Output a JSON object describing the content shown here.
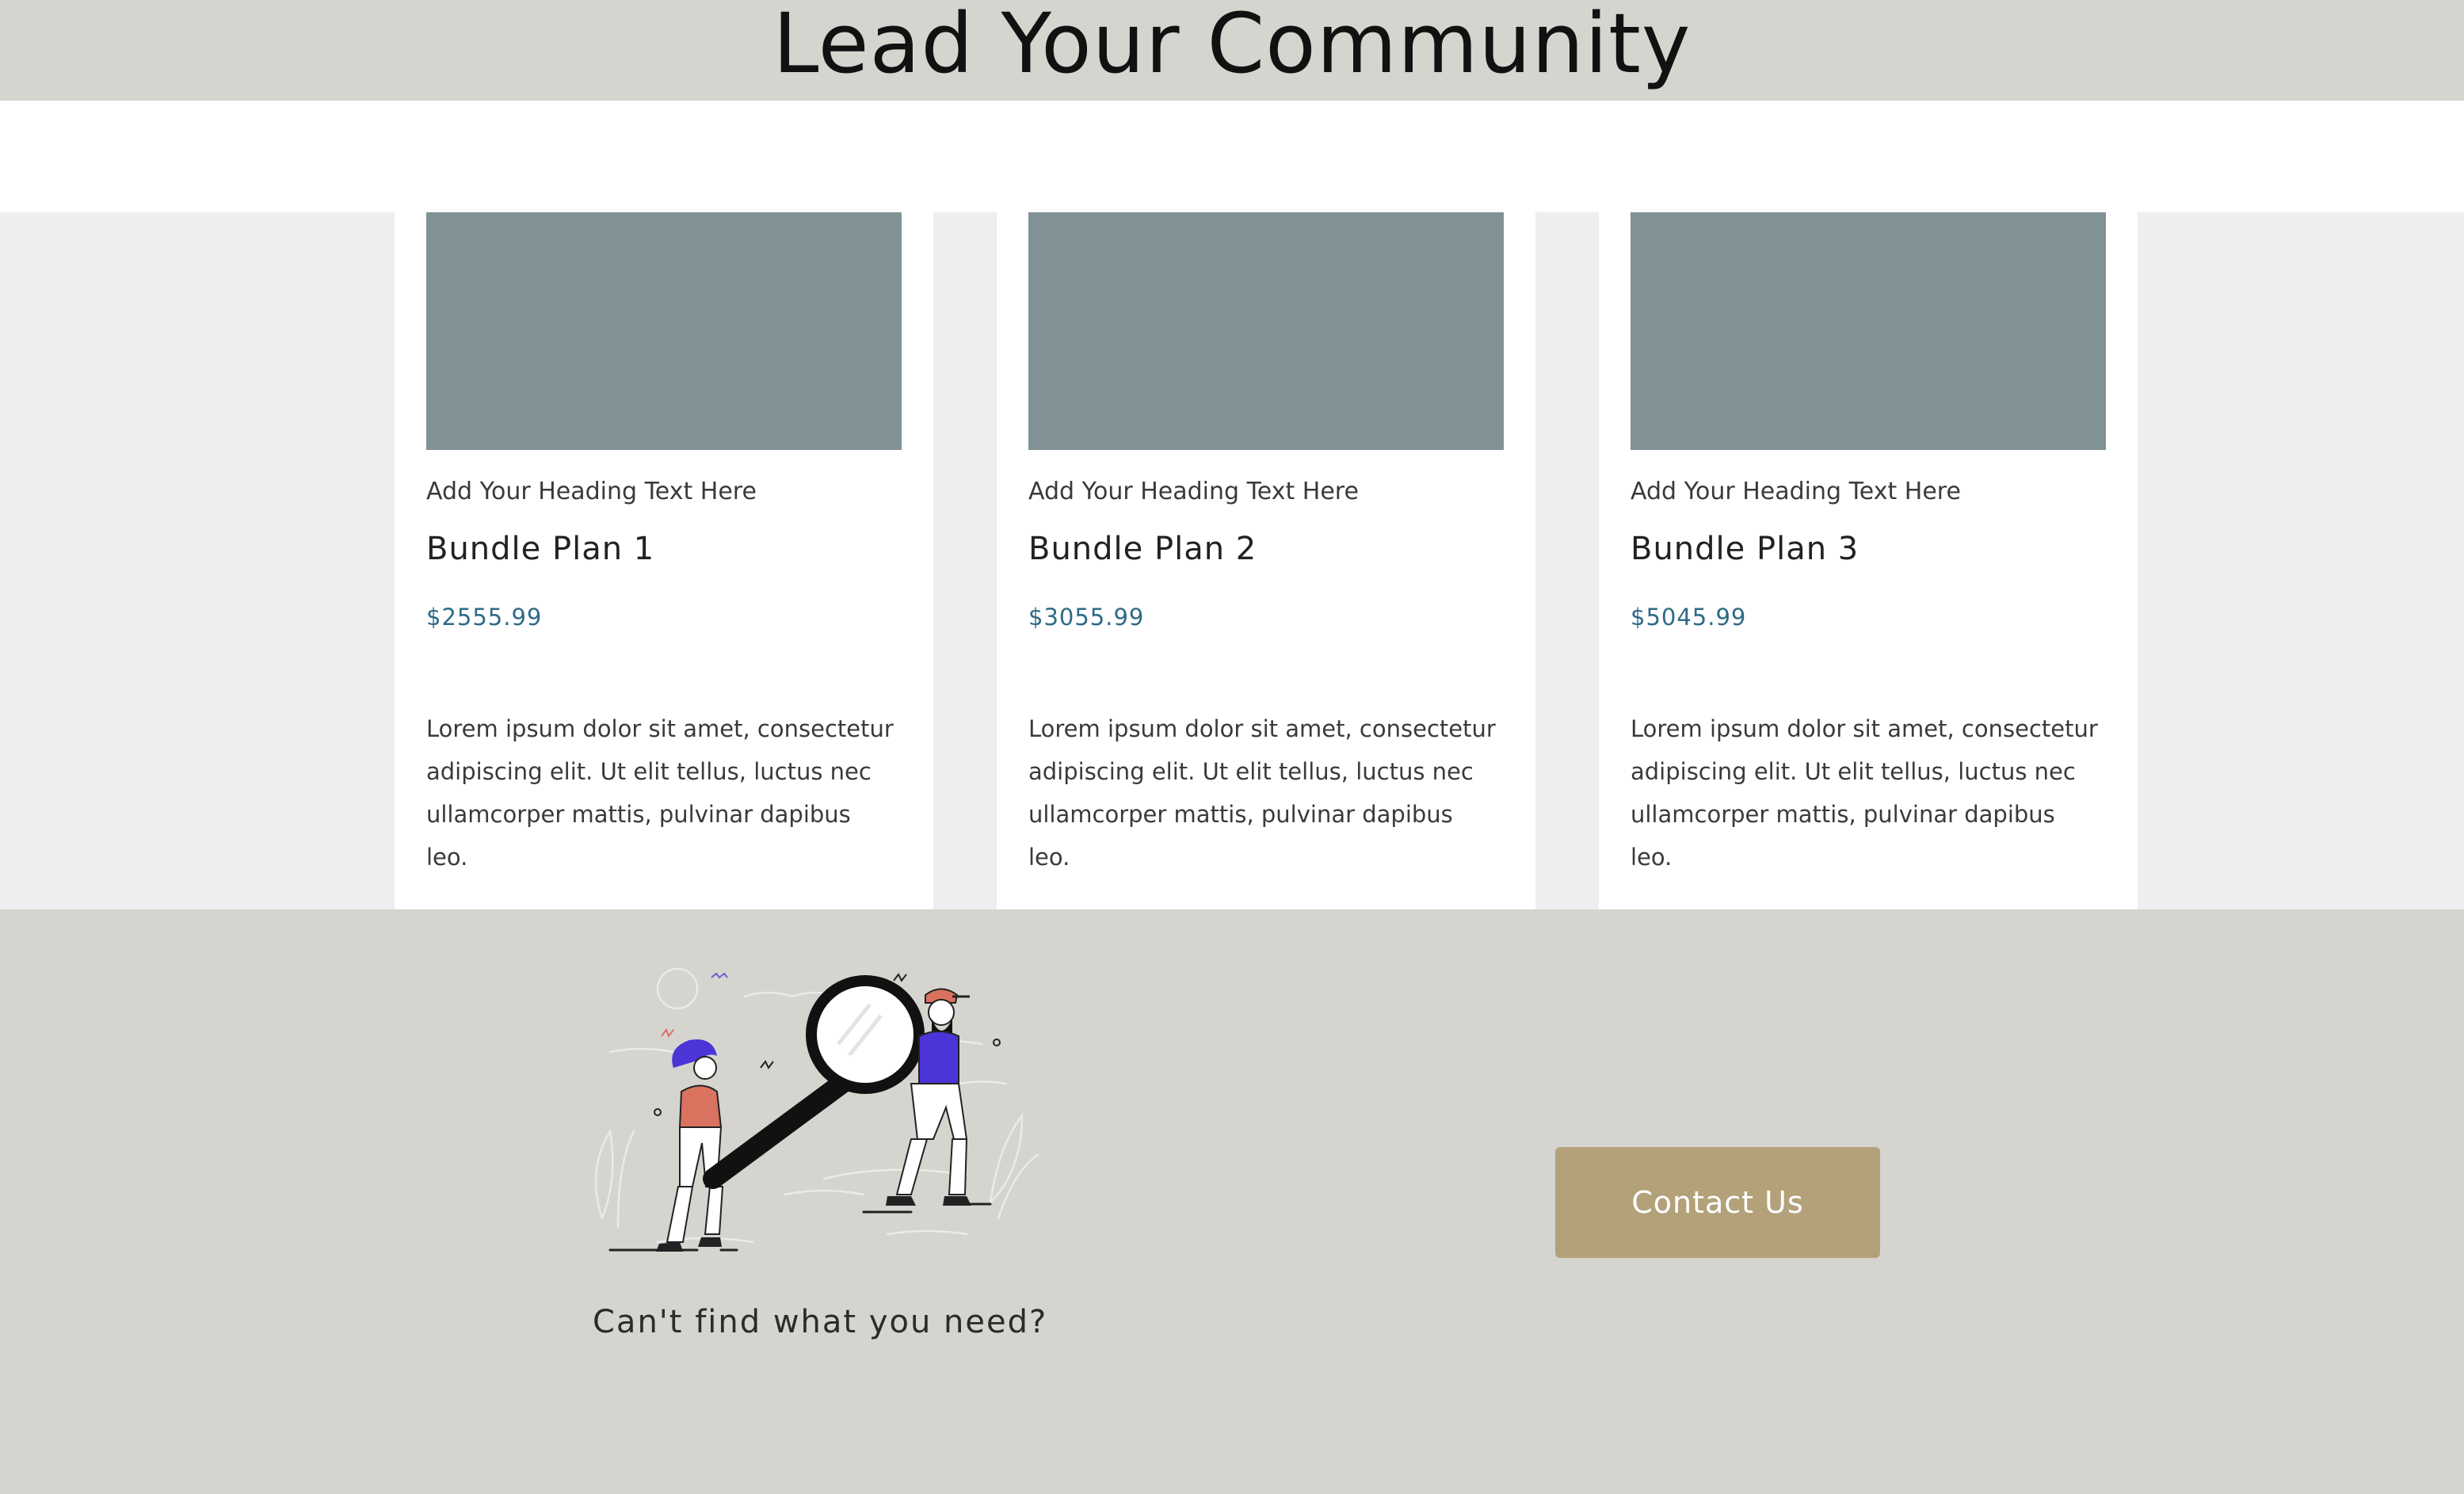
{
  "hero": {
    "title": "Lead Your Community"
  },
  "plans": [
    {
      "subheading": "Add Your Heading Text Here",
      "title": "Bundle Plan 1",
      "price": "$2555.99",
      "description": "Lorem ipsum dolor sit amet, consectetur adipiscing elit. Ut elit tellus, luctus nec ullamcorper mattis, pulvinar dapibus leo."
    },
    {
      "subheading": "Add Your Heading Text Here",
      "title": "Bundle Plan 2",
      "price": "$3055.99",
      "description": "Lorem ipsum dolor sit amet, consectetur adipiscing elit. Ut elit tellus, luctus nec ullamcorper mattis, pulvinar dapibus leo."
    },
    {
      "subheading": "Add Your Heading Text Here",
      "title": "Bundle Plan 3",
      "price": "$5045.99",
      "description": "Lorem ipsum dolor sit amet, consectetur adipiscing elit. Ut elit tellus, luctus nec ullamcorper mattis, pulvinar dapibus leo."
    }
  ],
  "footer": {
    "prompt": "Can't find what you need?",
    "contact_label": "Contact Us"
  },
  "colors": {
    "hero_band": "#d5d4cf",
    "cards_band": "#efeeee",
    "image_placeholder": "#809295",
    "price": "#2e6a86",
    "button": "#b3a17a"
  },
  "icons": {
    "illustration": "people-with-magnifier-illustration"
  }
}
